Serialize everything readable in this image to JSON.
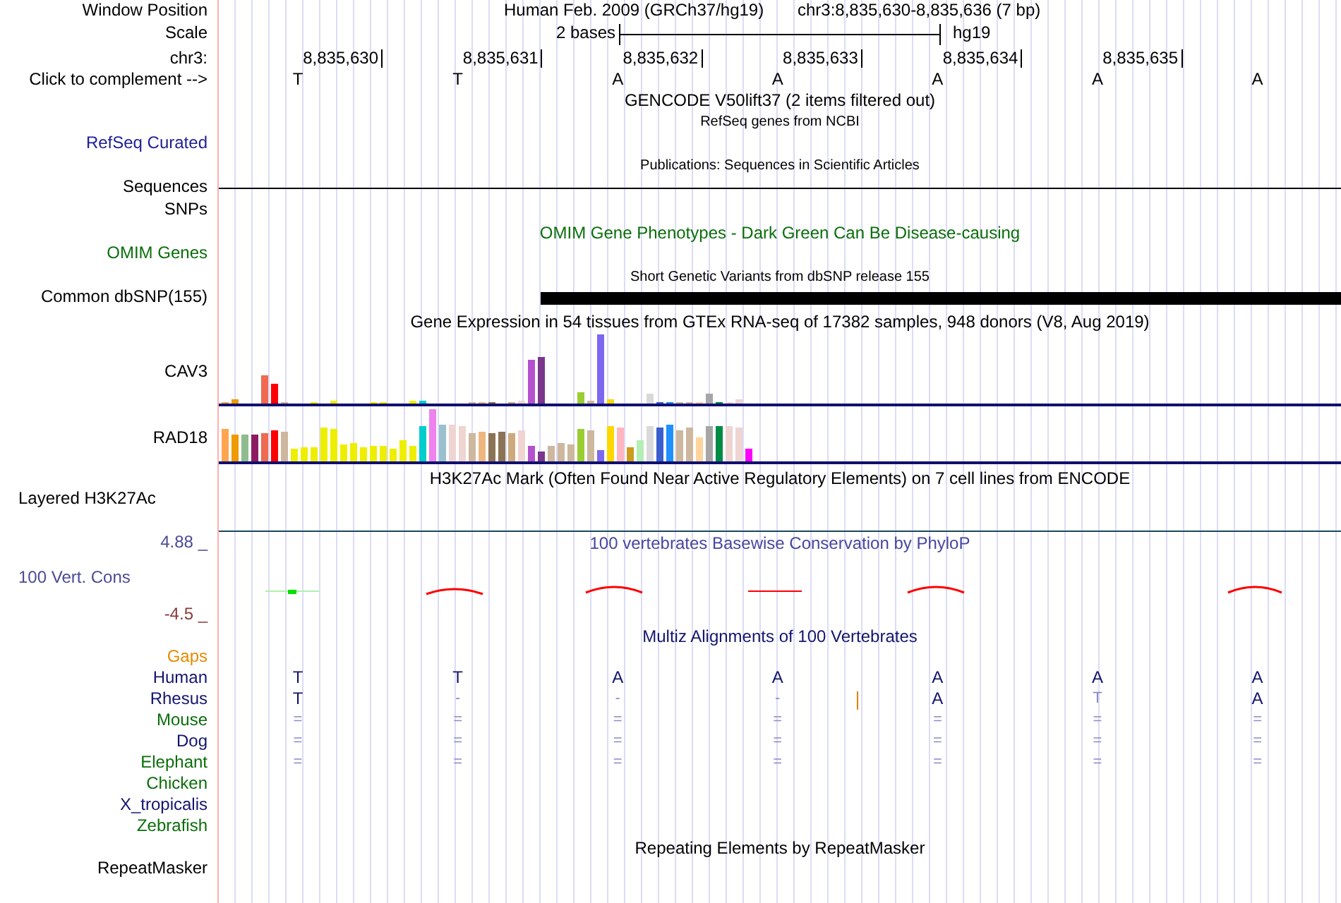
{
  "header": {
    "assembly": "Human Feb. 2009 (GRCh37/hg19)",
    "position": "chr3:8,835,630-8,835,636 (7 bp)"
  },
  "scale": {
    "label": "2 bases",
    "assembly": "hg19"
  },
  "ruler": [
    "8,835,630",
    "8,835,631",
    "8,835,632",
    "8,835,633",
    "8,835,634",
    "8,835,635"
  ],
  "bases": [
    "T",
    "T",
    "A",
    "A",
    "A",
    "A",
    "A"
  ],
  "labels": [
    {
      "text": "Window Position",
      "color": "#000000"
    },
    {
      "text": "Scale",
      "color": "#000000"
    },
    {
      "text": "chr3:",
      "color": "#000000"
    },
    {
      "text": "Click to complement -->",
      "color": "#000000"
    },
    {
      "text": "RefSeq Curated",
      "color": "#1e1e96"
    },
    {
      "text": "Sequences",
      "color": "#000000"
    },
    {
      "text": "SNPs",
      "color": "#000000"
    },
    {
      "text": "OMIM Genes",
      "color": "#0a6e0a"
    },
    {
      "text": "Common dbSNP(155)",
      "color": "#000000"
    },
    {
      "text": "CAV3",
      "color": "#000000"
    },
    {
      "text": "RAD18",
      "color": "#000000"
    },
    {
      "text": "Layered H3K27Ac",
      "color": "#000000"
    },
    {
      "text": "4.88 _",
      "color": "#4b4b96"
    },
    {
      "text": "100 Vert. Cons",
      "color": "#4b4b96"
    },
    {
      "text": "-4.5 _",
      "color": "#8b3a3a"
    },
    {
      "text": "Gaps",
      "color": "#e68a00"
    },
    {
      "text": "RepeatMasker",
      "color": "#000000"
    }
  ],
  "tracks": [
    {
      "title": "GENCODE V50lift37 (2 items filtered out)",
      "color": "#000000"
    },
    {
      "title": "RefSeq genes from NCBI",
      "color": "#000000"
    },
    {
      "title": "Publications: Sequences in Scientific Articles",
      "color": "#000000"
    },
    {
      "title": "OMIM Gene Phenotypes - Dark Green Can Be Disease-causing",
      "color": "#0a6e0a"
    },
    {
      "title": "Short Genetic Variants from dbSNP release 155",
      "color": "#000000"
    },
    {
      "title": "Gene Expression in 54 tissues from GTEx RNA-seq of 17382 samples, 948 donors (V8, Aug 2019)",
      "color": "#000000"
    },
    {
      "title": "H3K27Ac Mark (Often Found Near Active Regulatory Elements) on 7 cell lines from ENCODE",
      "color": "#000000"
    },
    {
      "title": "100 vertebrates Basewise Conservation by PhyloP",
      "color": "#4646a0"
    },
    {
      "title": "Multiz Alignments of 100 Vertebrates",
      "color": "#14146e"
    },
    {
      "title": "Repeating Elements by RepeatMasker",
      "color": "#000000"
    }
  ],
  "species": [
    {
      "name": "Human",
      "color": "#14146e",
      "bases": [
        {
          "b": "T",
          "faint": false,
          "insert": false
        },
        {
          "b": "T",
          "faint": false,
          "insert": false
        },
        {
          "b": "A",
          "faint": false,
          "insert": false
        },
        {
          "b": "A",
          "faint": false,
          "insert": false
        },
        {
          "b": "A",
          "faint": false,
          "insert": false
        },
        {
          "b": "A",
          "faint": false,
          "insert": false
        },
        {
          "b": "A",
          "faint": false,
          "insert": false
        }
      ]
    },
    {
      "name": "Rhesus",
      "color": "#14146e",
      "bases": [
        {
          "b": "T",
          "faint": false,
          "insert": false
        },
        {
          "b": "-",
          "faint": true,
          "insert": false
        },
        {
          "b": "-",
          "faint": true,
          "insert": false
        },
        {
          "b": "-",
          "faint": true,
          "insert": true
        },
        {
          "b": "A",
          "faint": false,
          "insert": false
        },
        {
          "b": "T",
          "faint": true,
          "insert": false
        },
        {
          "b": "A",
          "faint": false,
          "insert": false
        }
      ]
    },
    {
      "name": "Mouse",
      "color": "#0a6e0a",
      "bases": [
        {
          "b": "=",
          "faint": true,
          "insert": false
        },
        {
          "b": "=",
          "faint": true,
          "insert": false
        },
        {
          "b": "=",
          "faint": true,
          "insert": false
        },
        {
          "b": "=",
          "faint": true,
          "insert": false
        },
        {
          "b": "=",
          "faint": true,
          "insert": false
        },
        {
          "b": "=",
          "faint": true,
          "insert": false
        },
        {
          "b": "=",
          "faint": true,
          "insert": false
        }
      ]
    },
    {
      "name": "Dog",
      "color": "#14146e",
      "bases": [
        {
          "b": "=",
          "faint": true,
          "insert": false
        },
        {
          "b": "=",
          "faint": true,
          "insert": false
        },
        {
          "b": "=",
          "faint": true,
          "insert": false
        },
        {
          "b": "=",
          "faint": true,
          "insert": false
        },
        {
          "b": "=",
          "faint": true,
          "insert": false
        },
        {
          "b": "=",
          "faint": true,
          "insert": false
        },
        {
          "b": "=",
          "faint": true,
          "insert": false
        }
      ]
    },
    {
      "name": "Elephant",
      "color": "#0a6e0a",
      "bases": [
        {
          "b": "=",
          "faint": true,
          "insert": false
        },
        {
          "b": "=",
          "faint": true,
          "insert": false
        },
        {
          "b": "=",
          "faint": true,
          "insert": false
        },
        {
          "b": "=",
          "faint": true,
          "insert": false
        },
        {
          "b": "=",
          "faint": true,
          "insert": false
        },
        {
          "b": "=",
          "faint": true,
          "insert": false
        },
        {
          "b": "=",
          "faint": true,
          "insert": false
        }
      ]
    },
    {
      "name": "Chicken",
      "color": "#0a6e0a"
    },
    {
      "name": "X_tropicalis",
      "color": "#14146e"
    },
    {
      "name": "Zebrafish",
      "color": "#0a6e0a"
    }
  ]
}
